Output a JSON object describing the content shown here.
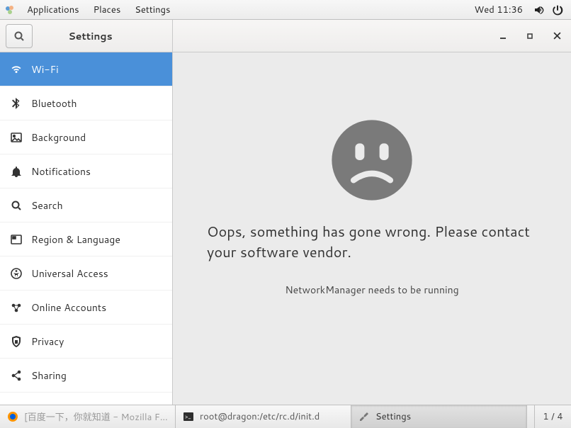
{
  "menubar": {
    "applications": "Applications",
    "places": "Places",
    "settings": "Settings",
    "clock": "Wed 11:36"
  },
  "window": {
    "title": "Settings"
  },
  "sidebar": {
    "items": [
      {
        "label": "Wi-Fi",
        "icon": "wifi-icon",
        "active": true
      },
      {
        "label": "Bluetooth",
        "icon": "bluetooth-icon",
        "active": false
      },
      {
        "label": "Background",
        "icon": "background-icon",
        "active": false
      },
      {
        "label": "Notifications",
        "icon": "bell-icon",
        "active": false
      },
      {
        "label": "Search",
        "icon": "search-icon",
        "active": false
      },
      {
        "label": "Region & Language",
        "icon": "region-icon",
        "active": false
      },
      {
        "label": "Universal Access",
        "icon": "accessibility-icon",
        "active": false
      },
      {
        "label": "Online Accounts",
        "icon": "online-accounts-icon",
        "active": false
      },
      {
        "label": "Privacy",
        "icon": "privacy-icon",
        "active": false
      },
      {
        "label": "Sharing",
        "icon": "sharing-icon",
        "active": false
      }
    ]
  },
  "content": {
    "error_title": "Oops, something has gone wrong. Please contact your software vendor.",
    "error_sub": "NetworkManager needs to be running"
  },
  "taskbar": {
    "items": [
      {
        "label": "[百度一下，你就知道 - Mozilla Fir...",
        "icon": "firefox-icon",
        "active": false,
        "muted": true
      },
      {
        "label": "root@dragon:/etc/rc.d/init.d",
        "icon": "terminal-icon",
        "active": false,
        "muted": false
      },
      {
        "label": "Settings",
        "icon": "settings-tool-icon",
        "active": true,
        "muted": false
      }
    ],
    "workspace": "1 / 4"
  }
}
